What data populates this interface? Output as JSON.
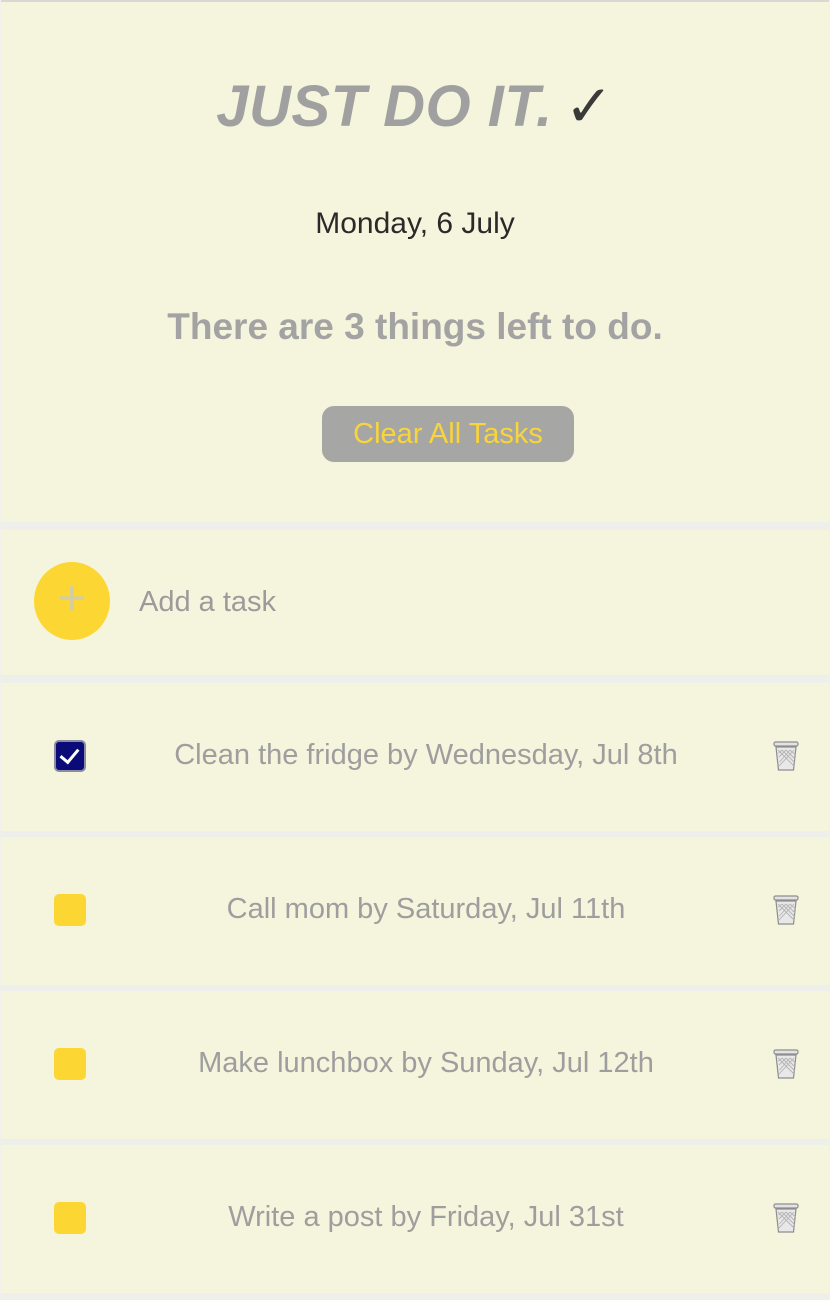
{
  "header": {
    "title": "JUST DO IT.",
    "title_mark": "✓",
    "date": "Monday, 6 July",
    "summary": "There are 3 things left to do.",
    "clear_button_label": "Clear All Tasks"
  },
  "add_task": {
    "button_symbol": "+",
    "placeholder": "Add a task",
    "value": ""
  },
  "tasks": [
    {
      "text": "Clean the fridge by Wednesday, Jul 8th",
      "checked": true
    },
    {
      "text": "Call mom by Saturday, Jul 11th",
      "checked": false
    },
    {
      "text": "Make lunchbox by Sunday, Jul 12th",
      "checked": false
    },
    {
      "text": "Write a post by Friday, Jul 31st",
      "checked": false
    }
  ],
  "icons": {
    "add": "plus-icon",
    "checkbox_checked": "checkmark-icon",
    "delete": "trash-can-icon"
  },
  "colors": {
    "background": "#f5f4dc",
    "accent_yellow": "#fcd733",
    "checked_navy": "#0a0a78",
    "muted_gray": "#a3a3a3"
  }
}
